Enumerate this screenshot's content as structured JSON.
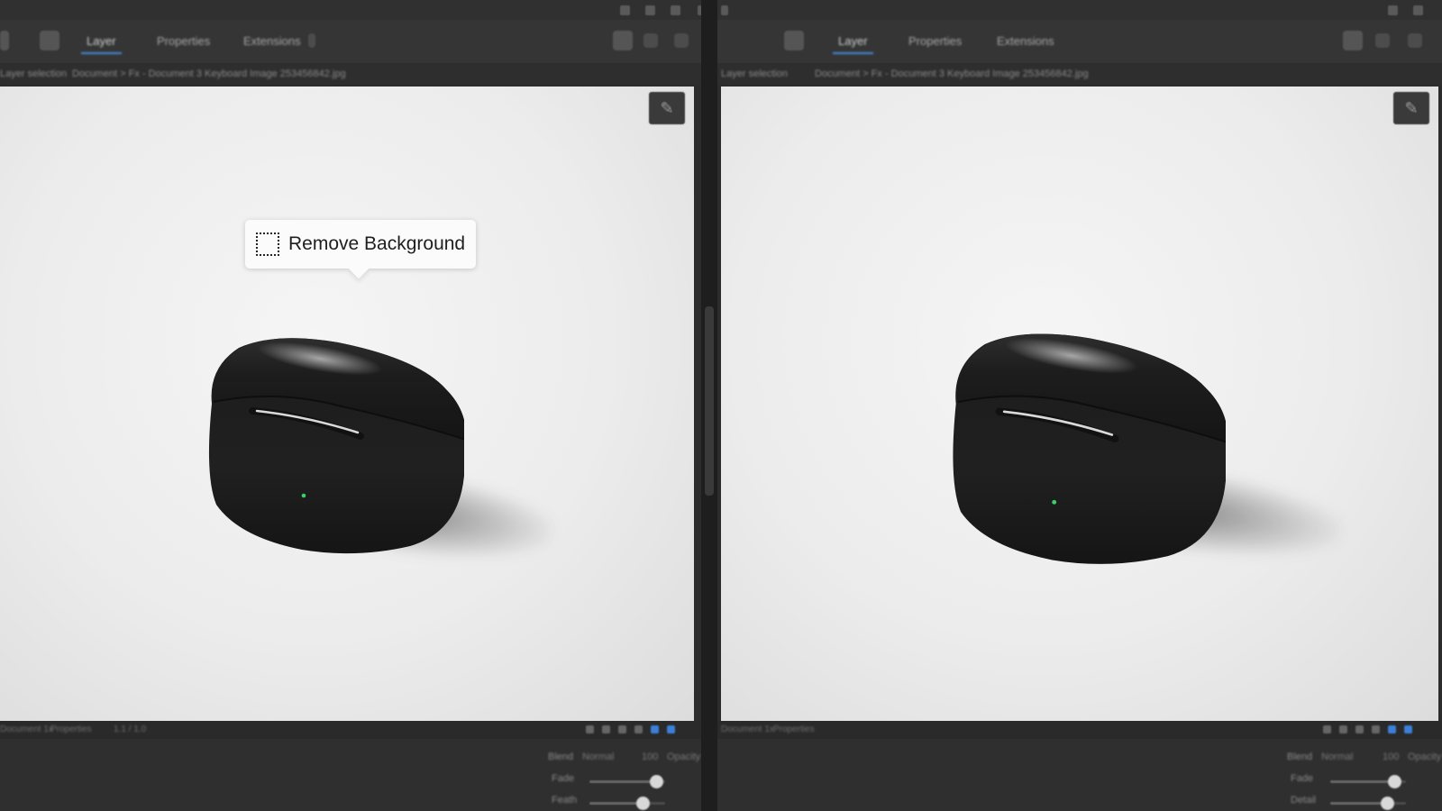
{
  "tooltip": {
    "label": "Remove Background",
    "icon": "dotted-selection-icon"
  },
  "left_pane": {
    "tabs": [
      "Layer",
      "Properties",
      "Extensions"
    ],
    "active_tab_index": 0,
    "breadcrumb_left": "Layer selection",
    "breadcrumb_path": "Document > Fx - Document 3 Keyboard Image 253456842.jpg",
    "status_left": "Document 1x",
    "status_mid": "Properties",
    "status_right": "1.1 / 1.0",
    "props": [
      {
        "label": "Blend",
        "value": "Normal",
        "extra": "100",
        "extra2": "Opacity"
      },
      {
        "label": "Fade",
        "slider_fraction": 0.88
      },
      {
        "label": "Feath",
        "slider_fraction": 0.7
      }
    ]
  },
  "right_pane": {
    "tabs": [
      "Layer",
      "Properties",
      "Extensions"
    ],
    "active_tab_index": 0,
    "breadcrumb_left": "Layer selection",
    "breadcrumb_path": "Document > Fx - Document 3 Keyboard Image 253456842.jpg",
    "status_left": "Document 1x",
    "status_mid": "Properties",
    "props": [
      {
        "label": "Blend",
        "value": "Normal",
        "extra": "100",
        "extra2": "Opacity"
      },
      {
        "label": "Fade",
        "slider_fraction": 0.85
      },
      {
        "label": "Detail",
        "slider_fraction": 0.75
      }
    ]
  },
  "colors": {
    "accent": "#4a8fe0",
    "canvas": "#efefef",
    "chrome": "#353535",
    "case": "#1f1f1f",
    "led": "#3cd06a"
  }
}
